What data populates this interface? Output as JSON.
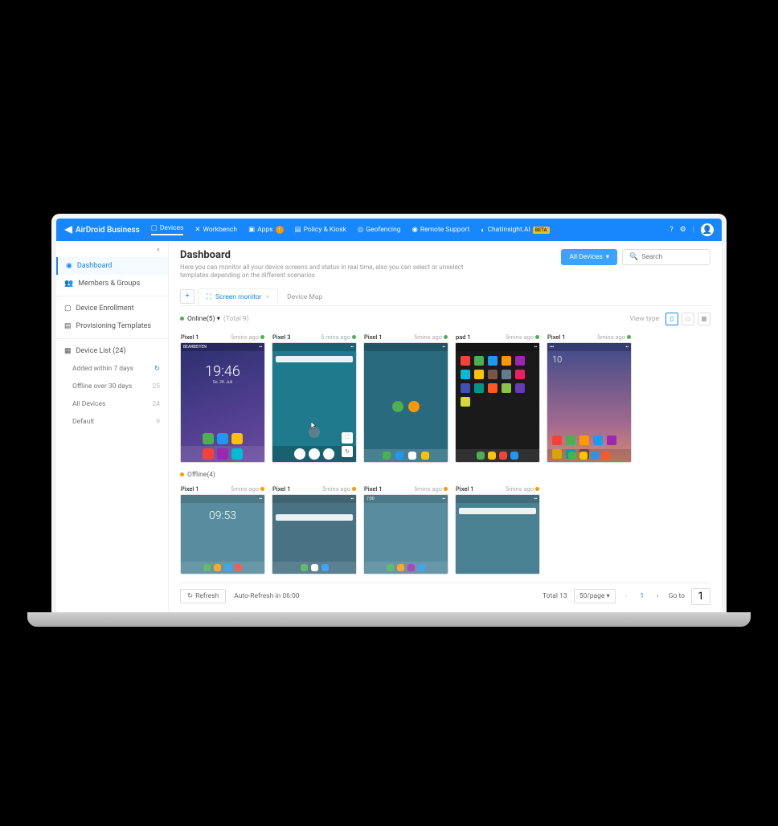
{
  "brand": "AirDroid Business",
  "nav": {
    "devices": "Devices",
    "workbench": "Workbench",
    "apps": "Apps",
    "apps_badge": "1",
    "policy": "Policy & Kiosk",
    "geofencing": "Geofencing",
    "remote": "Remote Support",
    "chatinsight": "ChatInsight.AI",
    "beta": "BETA"
  },
  "sidebar": {
    "dashboard": "Dashboard",
    "members": "Members & Groups",
    "enrollment": "Device Enrollment",
    "provisioning": "Provisioning Templates",
    "devicelist": "Device List (24)",
    "added7": {
      "label": "Added within 7 days",
      "icon": "refresh"
    },
    "offline30": {
      "label": "Offline over 30 days",
      "count": "25"
    },
    "alldevices": {
      "label": "All Devices",
      "count": "24"
    },
    "default": {
      "label": "Default",
      "count": "9"
    }
  },
  "header": {
    "title": "Dashboard",
    "subtitle": "Here you can monitor all your device screens and status in real time, also you can select or unselect templates depending on the different scenarios",
    "all_devices_btn": "All Devices",
    "search_placeholder": "Search"
  },
  "tabs": {
    "screen_monitor": "Screen monitor",
    "device_map": "Device Map"
  },
  "status": {
    "online_label": "Online(5)",
    "total_label": "(Total 9)",
    "offline_label": "Offline(4)",
    "view_type": "View type"
  },
  "online_devices": [
    {
      "name": "Pixel 1",
      "time": "5mins ago",
      "clock": "19:46",
      "date": "So. 24. Juli"
    },
    {
      "name": "Pixel 3",
      "time": "5 mins ago"
    },
    {
      "name": "Pixel 1",
      "time": "5mins ago"
    },
    {
      "name": "pad 1",
      "time": "5mins ago"
    },
    {
      "name": "Pixel 1",
      "time": "5mins ago",
      "clock2": "10"
    }
  ],
  "offline_devices": [
    {
      "name": "Pixel 1",
      "time": "5mins ago",
      "clock": "09:53"
    },
    {
      "name": "Pixel 1",
      "time": "5mins ago"
    },
    {
      "name": "Pixel 1",
      "time": "5mins ago",
      "clock": "7:00"
    },
    {
      "name": "Pixel 1",
      "time": "5mins ago"
    }
  ],
  "footer": {
    "refresh": "Refresh",
    "auto_refresh": "Auto-Refresh in 06:00",
    "total": "Total 13",
    "per_page": "50/page",
    "current_page": "1",
    "goto": "Go to",
    "goto_val": "1"
  }
}
